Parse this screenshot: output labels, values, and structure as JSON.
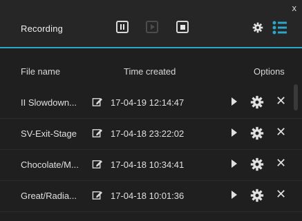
{
  "window": {
    "title": "Recording",
    "close_glyph": "x"
  },
  "toolbar": {
    "pause": {
      "icon": "pause-icon",
      "enabled": true
    },
    "play": {
      "icon": "play-icon",
      "enabled": false
    },
    "stop": {
      "icon": "stop-icon",
      "enabled": true
    },
    "settings": {
      "icon": "gear-icon"
    },
    "list": {
      "icon": "list-icon",
      "accent": "#2aa7c9"
    }
  },
  "table": {
    "headers": {
      "file_name": "File name",
      "time_created": "Time created",
      "options": "Options"
    },
    "rows": [
      {
        "file_name": "II Slowdown...",
        "time": "17-04-19 12:14:47"
      },
      {
        "file_name": "SV-Exit-Stage",
        "time": "17-04-18 23:22:02"
      },
      {
        "file_name": "Chocolate/M...",
        "time": "17-04-18 10:34:41"
      },
      {
        "file_name": "Great/Radia...",
        "time": "17-04-18 10:01:36"
      }
    ],
    "row_icons": [
      "edit-icon",
      "play-icon",
      "gear-icon",
      "delete-icon"
    ],
    "delete_glyph": "✕"
  },
  "colors": {
    "background": "#1f1f1f",
    "titlebar": "#262626",
    "accent": "#2aa7c9",
    "text": "#e0e0e0"
  }
}
